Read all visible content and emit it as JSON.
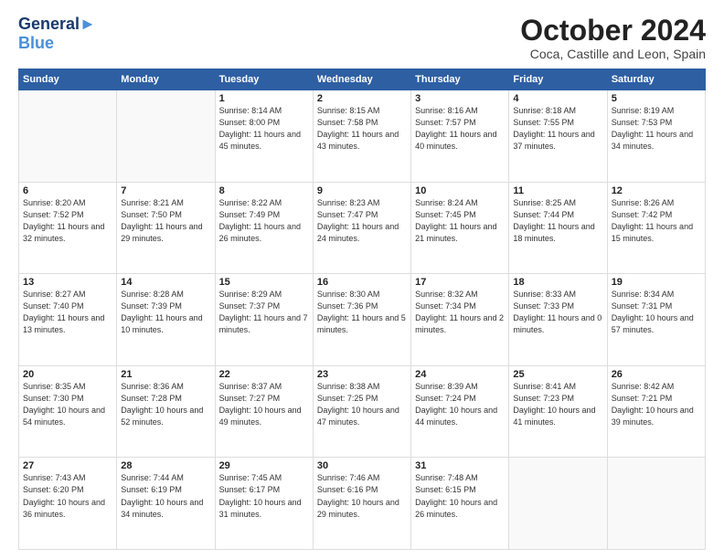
{
  "logo": {
    "line1": "General",
    "line2": "Blue"
  },
  "title": "October 2024",
  "subtitle": "Coca, Castille and Leon, Spain",
  "header_days": [
    "Sunday",
    "Monday",
    "Tuesday",
    "Wednesday",
    "Thursday",
    "Friday",
    "Saturday"
  ],
  "weeks": [
    [
      {
        "day": "",
        "sunrise": "",
        "sunset": "",
        "daylight": ""
      },
      {
        "day": "",
        "sunrise": "",
        "sunset": "",
        "daylight": ""
      },
      {
        "day": "1",
        "sunrise": "Sunrise: 8:14 AM",
        "sunset": "Sunset: 8:00 PM",
        "daylight": "Daylight: 11 hours and 45 minutes."
      },
      {
        "day": "2",
        "sunrise": "Sunrise: 8:15 AM",
        "sunset": "Sunset: 7:58 PM",
        "daylight": "Daylight: 11 hours and 43 minutes."
      },
      {
        "day": "3",
        "sunrise": "Sunrise: 8:16 AM",
        "sunset": "Sunset: 7:57 PM",
        "daylight": "Daylight: 11 hours and 40 minutes."
      },
      {
        "day": "4",
        "sunrise": "Sunrise: 8:18 AM",
        "sunset": "Sunset: 7:55 PM",
        "daylight": "Daylight: 11 hours and 37 minutes."
      },
      {
        "day": "5",
        "sunrise": "Sunrise: 8:19 AM",
        "sunset": "Sunset: 7:53 PM",
        "daylight": "Daylight: 11 hours and 34 minutes."
      }
    ],
    [
      {
        "day": "6",
        "sunrise": "Sunrise: 8:20 AM",
        "sunset": "Sunset: 7:52 PM",
        "daylight": "Daylight: 11 hours and 32 minutes."
      },
      {
        "day": "7",
        "sunrise": "Sunrise: 8:21 AM",
        "sunset": "Sunset: 7:50 PM",
        "daylight": "Daylight: 11 hours and 29 minutes."
      },
      {
        "day": "8",
        "sunrise": "Sunrise: 8:22 AM",
        "sunset": "Sunset: 7:49 PM",
        "daylight": "Daylight: 11 hours and 26 minutes."
      },
      {
        "day": "9",
        "sunrise": "Sunrise: 8:23 AM",
        "sunset": "Sunset: 7:47 PM",
        "daylight": "Daylight: 11 hours and 24 minutes."
      },
      {
        "day": "10",
        "sunrise": "Sunrise: 8:24 AM",
        "sunset": "Sunset: 7:45 PM",
        "daylight": "Daylight: 11 hours and 21 minutes."
      },
      {
        "day": "11",
        "sunrise": "Sunrise: 8:25 AM",
        "sunset": "Sunset: 7:44 PM",
        "daylight": "Daylight: 11 hours and 18 minutes."
      },
      {
        "day": "12",
        "sunrise": "Sunrise: 8:26 AM",
        "sunset": "Sunset: 7:42 PM",
        "daylight": "Daylight: 11 hours and 15 minutes."
      }
    ],
    [
      {
        "day": "13",
        "sunrise": "Sunrise: 8:27 AM",
        "sunset": "Sunset: 7:40 PM",
        "daylight": "Daylight: 11 hours and 13 minutes."
      },
      {
        "day": "14",
        "sunrise": "Sunrise: 8:28 AM",
        "sunset": "Sunset: 7:39 PM",
        "daylight": "Daylight: 11 hours and 10 minutes."
      },
      {
        "day": "15",
        "sunrise": "Sunrise: 8:29 AM",
        "sunset": "Sunset: 7:37 PM",
        "daylight": "Daylight: 11 hours and 7 minutes."
      },
      {
        "day": "16",
        "sunrise": "Sunrise: 8:30 AM",
        "sunset": "Sunset: 7:36 PM",
        "daylight": "Daylight: 11 hours and 5 minutes."
      },
      {
        "day": "17",
        "sunrise": "Sunrise: 8:32 AM",
        "sunset": "Sunset: 7:34 PM",
        "daylight": "Daylight: 11 hours and 2 minutes."
      },
      {
        "day": "18",
        "sunrise": "Sunrise: 8:33 AM",
        "sunset": "Sunset: 7:33 PM",
        "daylight": "Daylight: 11 hours and 0 minutes."
      },
      {
        "day": "19",
        "sunrise": "Sunrise: 8:34 AM",
        "sunset": "Sunset: 7:31 PM",
        "daylight": "Daylight: 10 hours and 57 minutes."
      }
    ],
    [
      {
        "day": "20",
        "sunrise": "Sunrise: 8:35 AM",
        "sunset": "Sunset: 7:30 PM",
        "daylight": "Daylight: 10 hours and 54 minutes."
      },
      {
        "day": "21",
        "sunrise": "Sunrise: 8:36 AM",
        "sunset": "Sunset: 7:28 PM",
        "daylight": "Daylight: 10 hours and 52 minutes."
      },
      {
        "day": "22",
        "sunrise": "Sunrise: 8:37 AM",
        "sunset": "Sunset: 7:27 PM",
        "daylight": "Daylight: 10 hours and 49 minutes."
      },
      {
        "day": "23",
        "sunrise": "Sunrise: 8:38 AM",
        "sunset": "Sunset: 7:25 PM",
        "daylight": "Daylight: 10 hours and 47 minutes."
      },
      {
        "day": "24",
        "sunrise": "Sunrise: 8:39 AM",
        "sunset": "Sunset: 7:24 PM",
        "daylight": "Daylight: 10 hours and 44 minutes."
      },
      {
        "day": "25",
        "sunrise": "Sunrise: 8:41 AM",
        "sunset": "Sunset: 7:23 PM",
        "daylight": "Daylight: 10 hours and 41 minutes."
      },
      {
        "day": "26",
        "sunrise": "Sunrise: 8:42 AM",
        "sunset": "Sunset: 7:21 PM",
        "daylight": "Daylight: 10 hours and 39 minutes."
      }
    ],
    [
      {
        "day": "27",
        "sunrise": "Sunrise: 7:43 AM",
        "sunset": "Sunset: 6:20 PM",
        "daylight": "Daylight: 10 hours and 36 minutes."
      },
      {
        "day": "28",
        "sunrise": "Sunrise: 7:44 AM",
        "sunset": "Sunset: 6:19 PM",
        "daylight": "Daylight: 10 hours and 34 minutes."
      },
      {
        "day": "29",
        "sunrise": "Sunrise: 7:45 AM",
        "sunset": "Sunset: 6:17 PM",
        "daylight": "Daylight: 10 hours and 31 minutes."
      },
      {
        "day": "30",
        "sunrise": "Sunrise: 7:46 AM",
        "sunset": "Sunset: 6:16 PM",
        "daylight": "Daylight: 10 hours and 29 minutes."
      },
      {
        "day": "31",
        "sunrise": "Sunrise: 7:48 AM",
        "sunset": "Sunset: 6:15 PM",
        "daylight": "Daylight: 10 hours and 26 minutes."
      },
      {
        "day": "",
        "sunrise": "",
        "sunset": "",
        "daylight": ""
      },
      {
        "day": "",
        "sunrise": "",
        "sunset": "",
        "daylight": ""
      }
    ]
  ]
}
